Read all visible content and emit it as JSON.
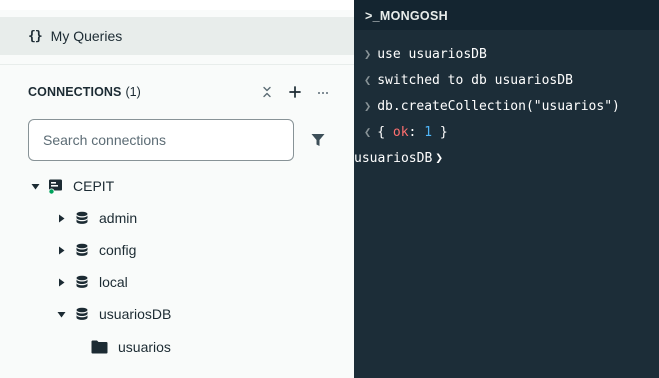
{
  "sidebar": {
    "my_queries": {
      "icon": "braces-icon",
      "braces": "{}",
      "label": "My Queries"
    },
    "connections": {
      "title": "CONNECTIONS",
      "count": "(1)"
    },
    "search": {
      "placeholder": "Search connections",
      "value": ""
    },
    "tree": {
      "connection": {
        "label": "CEPIT",
        "status_color": "#00a35c"
      },
      "databases": [
        {
          "label": "admin",
          "expanded": false
        },
        {
          "label": "config",
          "expanded": false
        },
        {
          "label": "local",
          "expanded": false
        },
        {
          "label": "usuariosDB",
          "expanded": true
        }
      ],
      "collections": [
        {
          "label": "usuarios"
        }
      ]
    }
  },
  "shell": {
    "title": ">_MONGOSH",
    "lines": [
      {
        "type": "input",
        "text": "use usuariosDB"
      },
      {
        "type": "output",
        "text": "switched to db usuariosDB"
      },
      {
        "type": "input",
        "text": "db.createCollection(\"usuarios\")"
      },
      {
        "type": "output",
        "open": "{ ",
        "key": "ok",
        "colon": ": ",
        "num": "1",
        "close": " }"
      }
    ],
    "prompt": {
      "db": "usuariosDB",
      "mark": "❯"
    }
  },
  "colors": {
    "shell_bg": "#1c2d38",
    "sidebar_bg": "#f9fbfa",
    "key": "#ff6f6f",
    "number": "#4fb5f7"
  }
}
